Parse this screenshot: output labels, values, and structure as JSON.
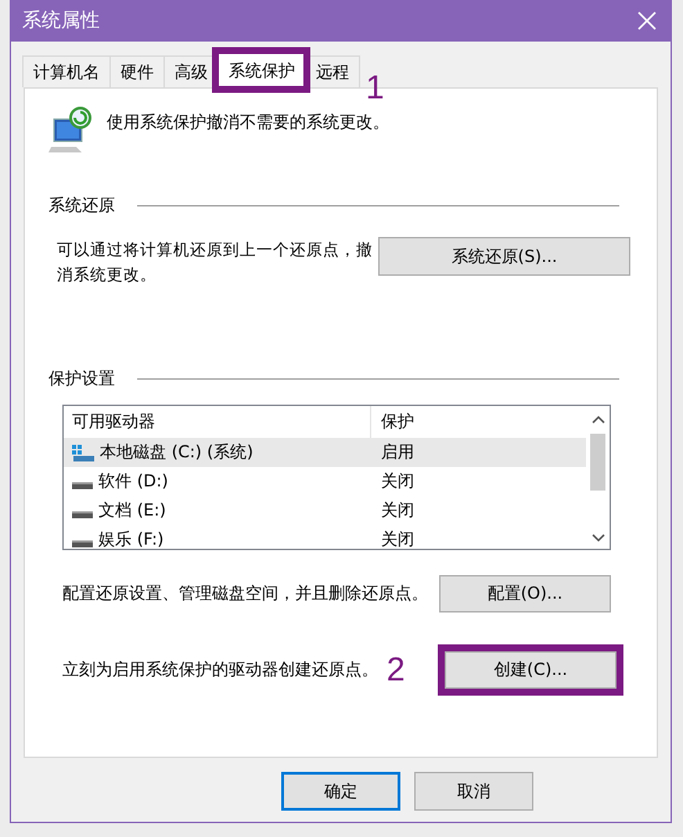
{
  "window": {
    "title": "系统属性"
  },
  "tabs": [
    {
      "label": "计算机名",
      "selected": false
    },
    {
      "label": "硬件",
      "selected": false
    },
    {
      "label": "高级",
      "selected": false
    },
    {
      "label": "系统保护",
      "selected": true,
      "callout": "1"
    },
    {
      "label": "远程",
      "selected": false
    }
  ],
  "intro": "使用系统保护撤消不需要的系统更改。",
  "restore": {
    "heading": "系统还原",
    "text": "可以通过将计算机还原到上一个还原点，撤消系统更改。",
    "button": "系统还原(S)..."
  },
  "protection": {
    "heading": "保护设置",
    "columns": [
      "可用驱动器",
      "保护"
    ],
    "rows": [
      {
        "kind": "system",
        "drive": "本地磁盘 (C:) (系统)",
        "status": "启用",
        "selected": true
      },
      {
        "kind": "drive",
        "drive": "软件 (D:)",
        "status": "关闭",
        "selected": false
      },
      {
        "kind": "drive",
        "drive": "文档 (E:)",
        "status": "关闭",
        "selected": false
      },
      {
        "kind": "drive",
        "drive": "娱乐 (F:)",
        "status": "关闭",
        "selected": false
      }
    ],
    "config_text": "配置还原设置、管理磁盘空间，并且删除还原点。",
    "config_button": "配置(O)...",
    "create_text": "立刻为启用系统保护的驱动器创建还原点。",
    "create_button": "创建(C)...",
    "create_callout": "2"
  },
  "buttons": [
    {
      "label": "确定",
      "default": true
    },
    {
      "label": "取消",
      "default": false
    }
  ]
}
